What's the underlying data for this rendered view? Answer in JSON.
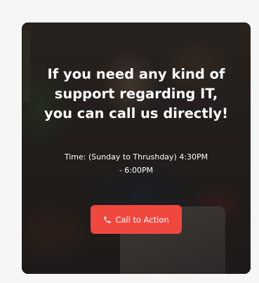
{
  "banner": {
    "heading_lines": [
      "If you need any kind of",
      "support regarding IT,",
      "you can call us directly!"
    ],
    "time_lines": [
      "Time: (Sunday to Thrushday) 4:30PM",
      "- 6:00PM"
    ],
    "cta": {
      "label": "Call to Action",
      "icon": "phone-icon",
      "color": "#f0473f"
    }
  }
}
